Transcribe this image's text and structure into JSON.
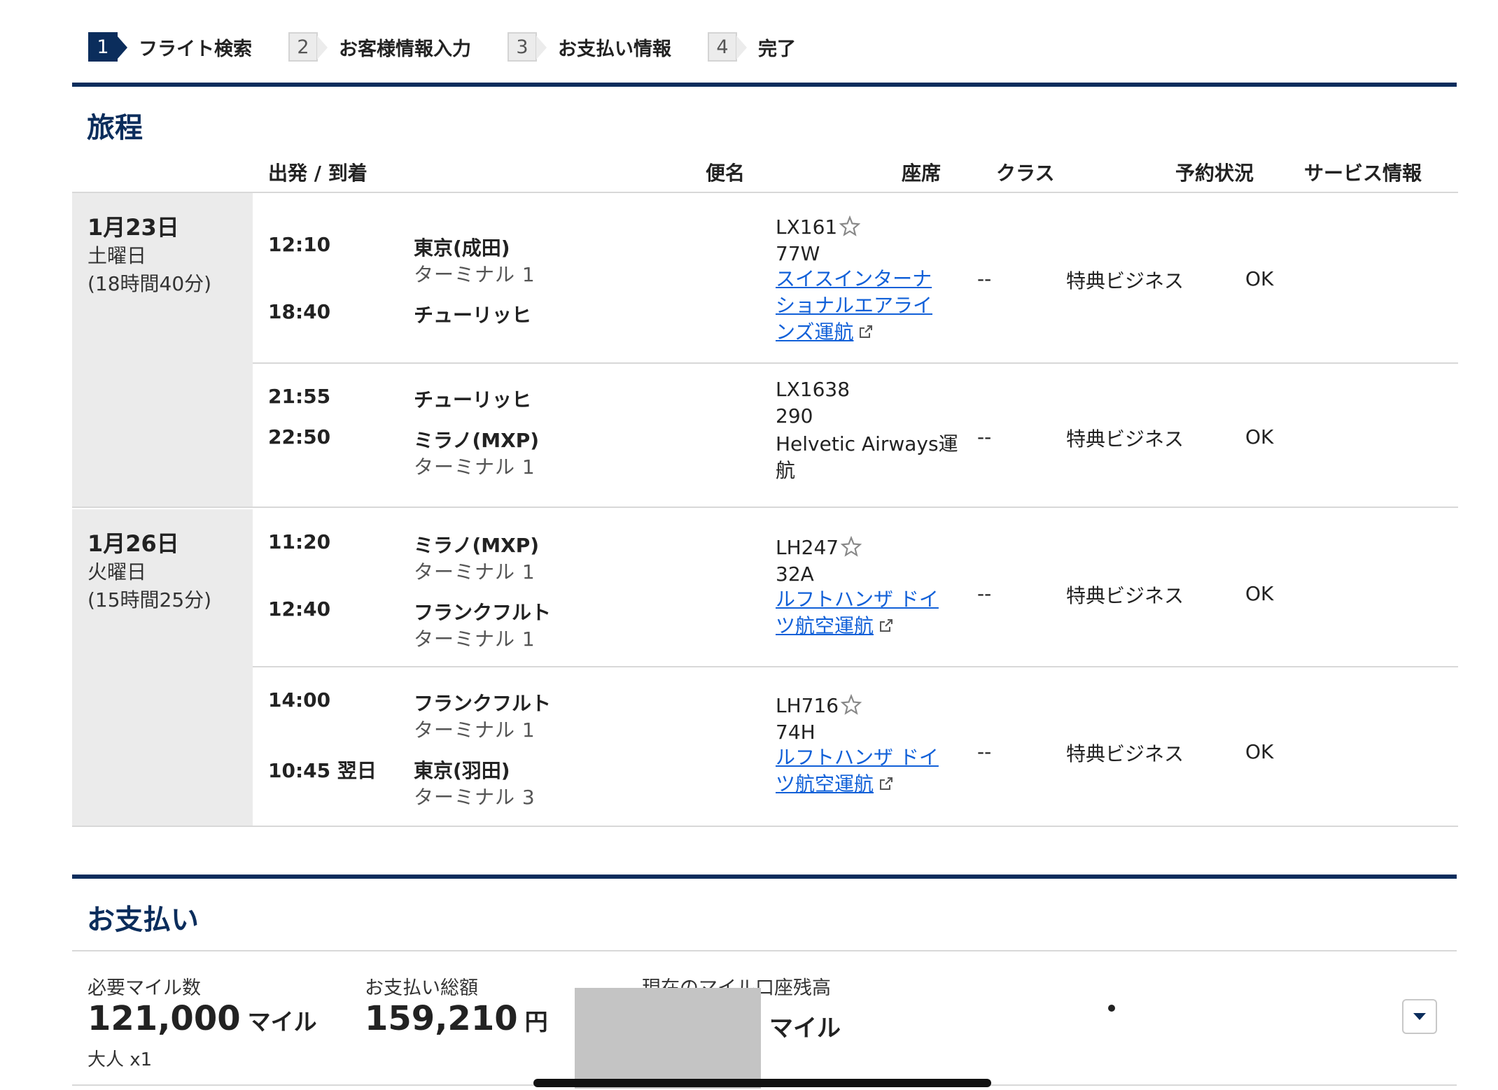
{
  "steps": [
    {
      "num": "1",
      "label": "フライト検索"
    },
    {
      "num": "2",
      "label": "お客様情報入力"
    },
    {
      "num": "3",
      "label": "お支払い情報"
    },
    {
      "num": "4",
      "label": "完了"
    }
  ],
  "itinerary": {
    "title": "旅程",
    "headers": {
      "dep_arr": "出発 / 到着",
      "flight": "便名",
      "seat": "座席",
      "class": "クラス",
      "status": "予約状況",
      "service": "サービス情報"
    },
    "days": [
      {
        "date": "1月23日",
        "dow": "土曜日",
        "duration": "(18時間40分)",
        "segments": [
          {
            "dep_time": "12:10",
            "dep_city": "東京(成田)",
            "dep_terminal": "ターミナル 1",
            "arr_time": "18:40",
            "arr_city": "チューリッヒ",
            "arr_terminal": "",
            "flight_no": "LX161",
            "aircraft": "77W",
            "operator_lines": [
              "スイスインターナ",
              "ショナルエアライ",
              "ンズ運航"
            ],
            "operator_link": true,
            "seat": "--",
            "class": "特典ビジネス",
            "status": "OK"
          },
          {
            "dep_time": "21:55",
            "dep_city": "チューリッヒ",
            "dep_terminal": "",
            "arr_time": "22:50",
            "arr_city": "ミラノ(MXP)",
            "arr_terminal": "ターミナル 1",
            "flight_no": "LX1638",
            "aircraft": "290",
            "operator_lines": [
              "Helvetic Airways運",
              "航"
            ],
            "operator_link": false,
            "seat": "--",
            "class": "特典ビジネス",
            "status": "OK"
          }
        ]
      },
      {
        "date": "1月26日",
        "dow": "火曜日",
        "duration": "(15時間25分)",
        "segments": [
          {
            "dep_time": "11:20",
            "dep_city": "ミラノ(MXP)",
            "dep_terminal": "ターミナル 1",
            "arr_time": "12:40",
            "arr_city": "フランクフルト",
            "arr_terminal": "ターミナル 1",
            "flight_no": "LH247",
            "aircraft": "32A",
            "operator_lines": [
              "ルフトハンザ ドイ",
              "ツ航空運航"
            ],
            "operator_link": true,
            "seat": "--",
            "class": "特典ビジネス",
            "status": "OK"
          },
          {
            "dep_time": "14:00",
            "dep_city": "フランクフルト",
            "dep_terminal": "ターミナル 1",
            "arr_time": "10:45 翌日",
            "arr_city": "東京(羽田)",
            "arr_terminal": "ターミナル 3",
            "flight_no": "LH716",
            "aircraft": "74H",
            "operator_lines": [
              "ルフトハンザ ドイ",
              "ツ航空運航"
            ],
            "operator_link": true,
            "seat": "--",
            "class": "特典ビジネス",
            "status": "OK"
          }
        ]
      }
    ]
  },
  "payment": {
    "title": "お支払い",
    "miles_label": "必要マイル数",
    "miles_value": "121,000",
    "miles_unit": "マイル",
    "passengers": "大人 x1",
    "total_label": "お支払い総額",
    "total_value": "159,210",
    "total_unit": "円",
    "balance_label": "現在のマイル口座残高",
    "balance_unit": "マイル"
  },
  "colors": {
    "brand_navy": "#0b2d5c",
    "link_blue": "#1160d8",
    "date_column_bg": "#ebebeb"
  }
}
